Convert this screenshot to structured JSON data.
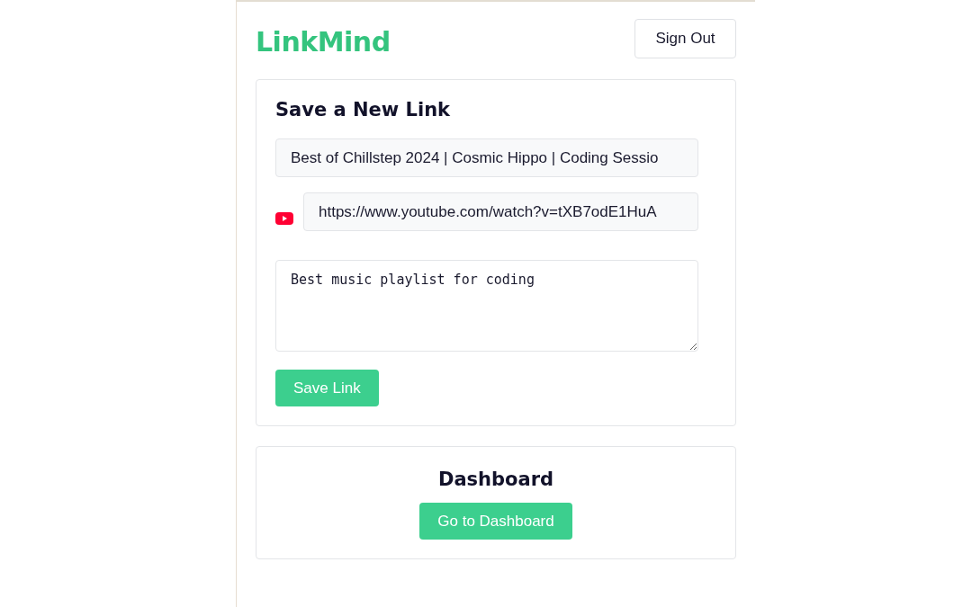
{
  "header": {
    "logo": "LinkMind",
    "sign_out": "Sign Out"
  },
  "save_card": {
    "title": "Save a New Link",
    "title_field": {
      "value": "Best of Chillstep 2024 | Cosmic Hippo | Coding Sessio"
    },
    "url_field": {
      "value": "https://www.youtube.com/watch?v=tXB7odE1HuA"
    },
    "note_field": {
      "value": "Best music playlist for coding"
    },
    "button": "Save Link"
  },
  "dashboard_card": {
    "title": "Dashboard",
    "button": "Go to Dashboard"
  }
}
